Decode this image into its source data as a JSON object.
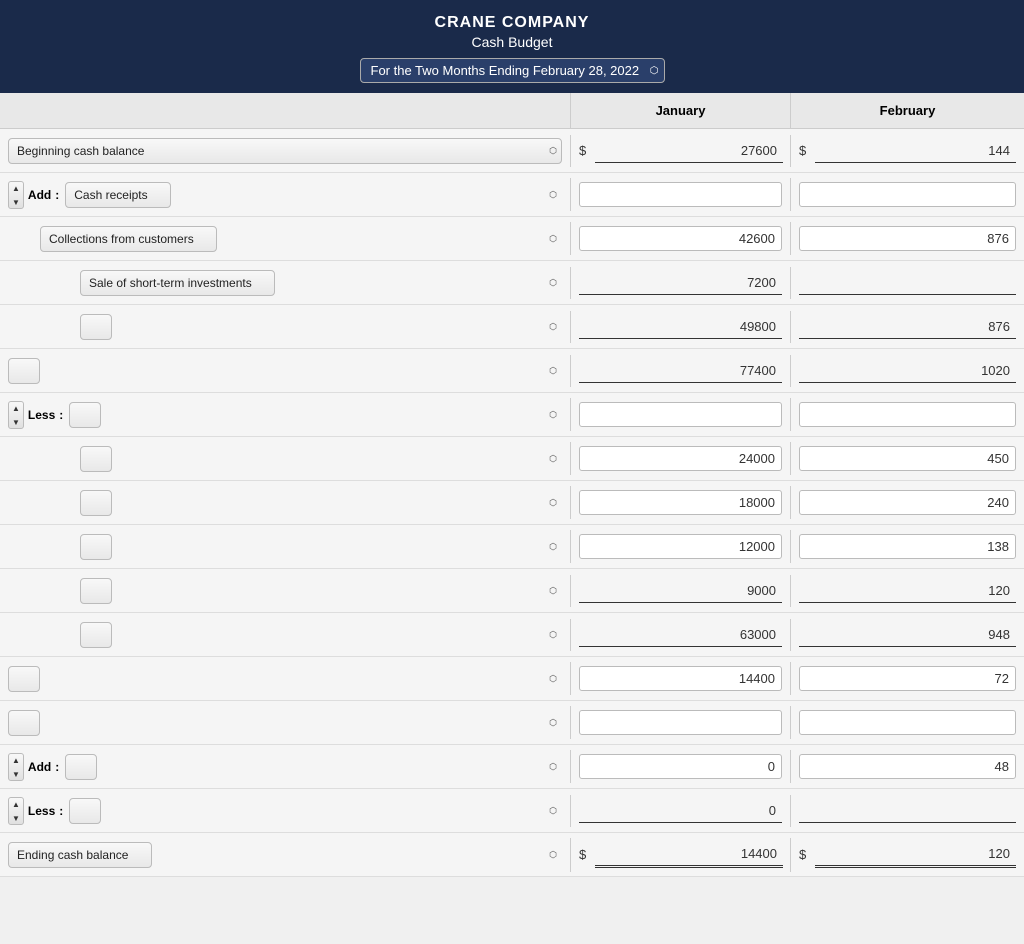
{
  "header": {
    "company": "CRANE COMPANY",
    "title": "Cash Budget",
    "period": "For the Two Months Ending February 28, 2022"
  },
  "columns": {
    "january": "January",
    "february": "February"
  },
  "rows": [
    {
      "id": "beginning-cash",
      "type": "main-label",
      "label": "Beginning cash balance",
      "jan_dollar": "$",
      "jan_value": "27600",
      "feb_dollar": "$",
      "feb_value": "144",
      "underline": "single"
    },
    {
      "id": "cash-receipts",
      "type": "prefix-label",
      "prefix": "Add",
      "separator": ":",
      "label": "Cash receipts",
      "jan_value": "",
      "feb_value": ""
    },
    {
      "id": "collections",
      "type": "indent-label",
      "label": "Collections from customers",
      "jan_value": "42600",
      "feb_value": "876",
      "underline": "none"
    },
    {
      "id": "short-term",
      "type": "indent-label",
      "label": "Sale of short-term investments",
      "jan_value": "7200",
      "feb_value": "",
      "underline": "none"
    },
    {
      "id": "subtotal1",
      "type": "indent-empty",
      "label": "",
      "jan_value": "49800",
      "feb_value": "876",
      "underline": "single"
    },
    {
      "id": "total-available",
      "type": "main-empty",
      "label": "",
      "jan_value": "77400",
      "feb_value": "1020",
      "underline": "single"
    },
    {
      "id": "less-header",
      "type": "prefix-label",
      "prefix": "Less",
      "separator": ":",
      "label": "",
      "jan_value": "",
      "feb_value": ""
    },
    {
      "id": "disbursement1",
      "type": "indent-empty2",
      "label": "",
      "jan_value": "24000",
      "feb_value": "450",
      "underline": "none"
    },
    {
      "id": "disbursement2",
      "type": "indent-empty2",
      "label": "",
      "jan_value": "18000",
      "feb_value": "240",
      "underline": "none"
    },
    {
      "id": "disbursement3",
      "type": "indent-empty2",
      "label": "",
      "jan_value": "12000",
      "feb_value": "138",
      "underline": "none"
    },
    {
      "id": "disbursement4",
      "type": "indent-empty2",
      "label": "",
      "jan_value": "9000",
      "feb_value": "120",
      "underline": "none"
    },
    {
      "id": "total-disbursements",
      "type": "indent-empty2",
      "label": "",
      "jan_value": "63000",
      "feb_value": "948",
      "underline": "single"
    },
    {
      "id": "excess",
      "type": "main-empty",
      "label": "",
      "jan_value": "14400",
      "feb_value": "72",
      "underline": "none"
    },
    {
      "id": "blank1",
      "type": "main-empty-blank",
      "label": "",
      "jan_value": "",
      "feb_value": ""
    },
    {
      "id": "add-financing",
      "type": "prefix-label",
      "prefix": "Add",
      "separator": ":",
      "label": "",
      "jan_value": "0",
      "feb_value": "48",
      "underline": "none"
    },
    {
      "id": "less-financing",
      "type": "prefix-label",
      "prefix": "Less",
      "separator": ":",
      "label": "",
      "jan_value": "0",
      "feb_value": "",
      "underline": "none"
    },
    {
      "id": "ending-cash",
      "type": "main-label",
      "label": "Ending cash balance",
      "jan_dollar": "$",
      "jan_value": "14400",
      "feb_dollar": "$",
      "feb_value": "120",
      "underline": "double"
    }
  ]
}
